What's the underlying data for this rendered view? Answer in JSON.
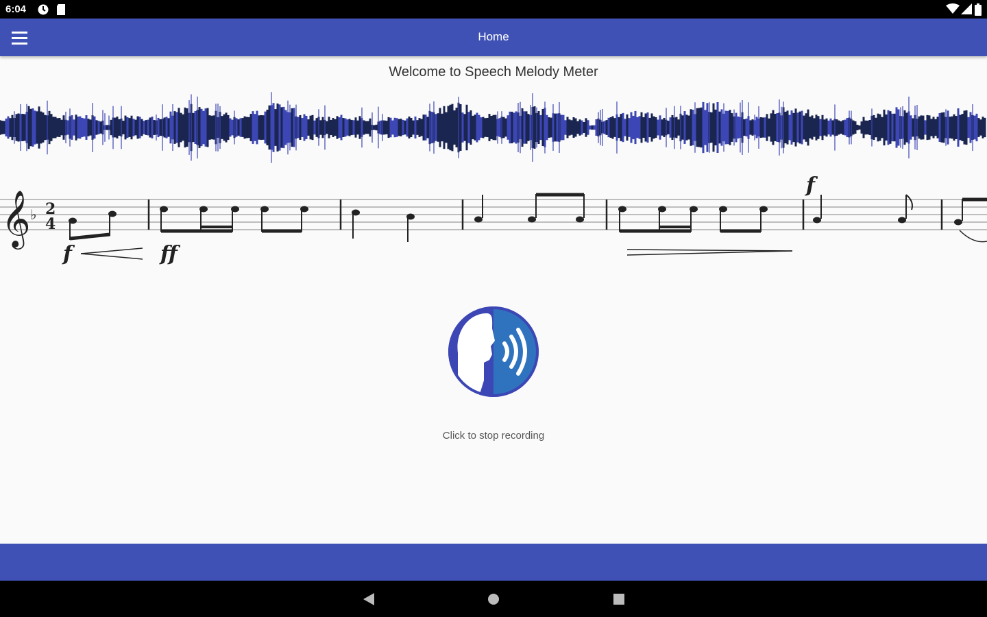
{
  "status_bar": {
    "time": "6:04",
    "left_icons": [
      "sync-icon",
      "sd-card-icon"
    ],
    "right_icons": [
      "wifi-icon",
      "signal-icon",
      "battery-icon"
    ]
  },
  "app_bar": {
    "title": "Home",
    "menu_icon": "hamburger-menu-icon",
    "color": "#3f51b5"
  },
  "main": {
    "welcome_text": "Welcome to Speech Melody Meter",
    "record_button_icon": "speaking-head-icon",
    "record_caption": "Click to stop recording",
    "accent_colors": {
      "dark_blue": "#3c46b4",
      "light_blue": "#2f73bf",
      "waveform": "#1a2550"
    }
  },
  "banner": {
    "time_signature": {
      "top": "2",
      "bottom": "4"
    },
    "dynamics": [
      "f",
      "ff",
      "f"
    ]
  },
  "nav_bar": {
    "buttons": [
      "back-icon",
      "home-icon",
      "recents-icon"
    ]
  }
}
